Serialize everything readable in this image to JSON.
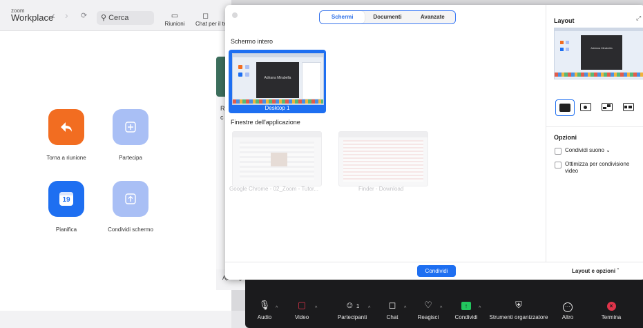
{
  "zoom": {
    "logo_small": "zoom",
    "logo_big": "Workplace",
    "search_placeholder": "Cerca",
    "nav": [
      {
        "label": "Riunioni",
        "icon": "video-icon"
      },
      {
        "label": "Chat per il te",
        "icon": "chat-icon"
      }
    ],
    "tiles": [
      {
        "label": "Torna a riunione",
        "color": "#f26d21",
        "icon": "return-arrow-icon"
      },
      {
        "label": "Partecipa",
        "color": "#a9bff5",
        "icon": "plus-icon"
      },
      {
        "label": "Pianifica",
        "color": "#1e6ff1",
        "icon": "calendar-icon",
        "day": "19"
      },
      {
        "label": "Condividi schermo",
        "color": "#a9bff5",
        "icon": "upload-arrow-icon"
      }
    ],
    "apri_text": "Apri reg"
  },
  "dialog": {
    "tabs": [
      "Schermi",
      "Documenti",
      "Avanzate"
    ],
    "active_tab": "Schermi",
    "section_full": "Schermo intero",
    "desktop_label": "Desktop 1",
    "section_apps": "Finestre dell'applicazione",
    "apps": [
      {
        "label": "Google Chrome - 02_Zoom - Tutor..."
      },
      {
        "label": "Finder - Download"
      }
    ],
    "thumb_name": "Adriana Mirabella",
    "share_button": "Condividi",
    "layout_options_link": "Layout e opzioni",
    "right_panel": {
      "layout_title": "Layout",
      "options_title": "Opzioni",
      "options": [
        {
          "label": "Condividi suono",
          "has_caret": true
        },
        {
          "label": "Ottimizza per condivisione video",
          "has_caret": false
        }
      ]
    }
  },
  "toolbar": {
    "items": [
      {
        "label": "Audio",
        "icon": "microphone-icon",
        "caret": true
      },
      {
        "label": "Video",
        "icon": "video-off-icon",
        "caret": true
      },
      {
        "label": "Partecipanti",
        "icon": "participants-icon",
        "count": "1",
        "caret": true
      },
      {
        "label": "Chat",
        "icon": "chat-icon",
        "caret": true
      },
      {
        "label": "Reagisci",
        "icon": "heart-icon",
        "caret": true
      },
      {
        "label": "Condividi",
        "icon": "share-icon",
        "caret": true
      },
      {
        "label": "Strumenti organizzatore",
        "icon": "shield-icon",
        "caret": false
      },
      {
        "label": "Altro",
        "icon": "more-icon",
        "caret": false
      },
      {
        "label": "Termina",
        "icon": "end-icon",
        "caret": false
      }
    ]
  },
  "colors": {
    "accent": "#1e6ff1",
    "end": "#e0344a",
    "share_green": "#22c55e",
    "toolbar_bg": "#1b1b1d"
  }
}
